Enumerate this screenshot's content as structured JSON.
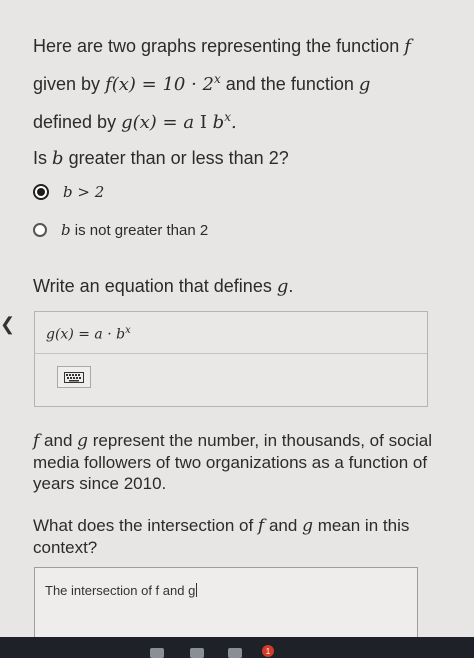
{
  "question1": {
    "line1": "Here are two graphs representing the function",
    "f": "f",
    "given_by": "given by",
    "f_def": "f(x) = 10 · 2",
    "x_sup": "x",
    "and_function": "and the function",
    "g": "g",
    "defined_by": "defined by",
    "g_def": "g(x) = a",
    "b_sup": "b"
  },
  "question2": {
    "prompt_prefix": "Is",
    "b": "b",
    "prompt_suffix": "greater than or less than 2?",
    "options": [
      {
        "math": "b > 2",
        "text": "",
        "selected": true
      },
      {
        "math": "b",
        "text": "is not greater than 2",
        "selected": false
      }
    ]
  },
  "question3": {
    "prompt": "Write an equation that defines",
    "g": "g",
    "period": ".",
    "equation": "g(x) = a · b",
    "equation_sup": "x",
    "keyboard_icon": "keyboard-icon"
  },
  "paragraph": {
    "f": "f",
    "and": "and",
    "g": "g",
    "text": "represent the number, in thousands, of social media followers of two organizations as a function of years since 2010."
  },
  "question4": {
    "prompt_a": "What does the intersection of",
    "f": "f",
    "and": "and",
    "g": "g",
    "prompt_b": "mean in this context?",
    "answer_text": "The intersection of f and g"
  },
  "taskbar": {
    "badge_count": "1"
  },
  "colors": {
    "background": "#e7e6e4",
    "taskbar": "#1e2228",
    "badge": "#d23b2a"
  }
}
